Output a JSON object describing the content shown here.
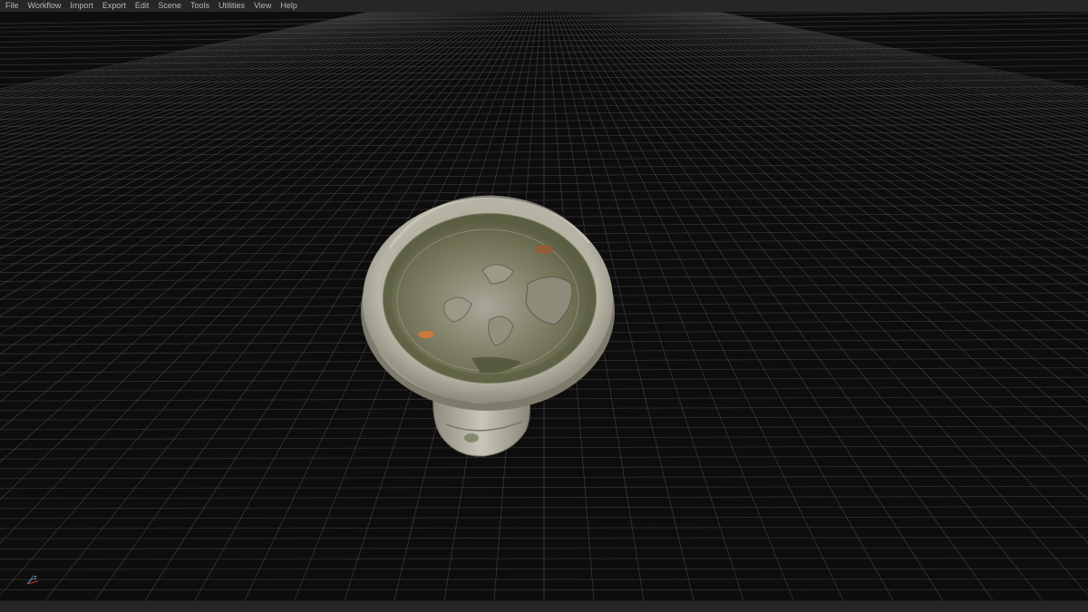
{
  "menu": {
    "items": [
      {
        "label": "File",
        "name": "menu-file"
      },
      {
        "label": "Workflow",
        "name": "menu-workflow"
      },
      {
        "label": "Import",
        "name": "menu-import"
      },
      {
        "label": "Export",
        "name": "menu-export"
      },
      {
        "label": "Edit",
        "name": "menu-edit"
      },
      {
        "label": "Scene",
        "name": "menu-scene"
      },
      {
        "label": "Tools",
        "name": "menu-tools"
      },
      {
        "label": "Utilities",
        "name": "menu-utilities"
      },
      {
        "label": "View",
        "name": "menu-view"
      },
      {
        "label": "Help",
        "name": "menu-help"
      }
    ]
  },
  "viewport": {
    "axis_gizmo": {
      "z_label": "Z",
      "icon": "axis-gizmo-icon"
    },
    "model": {
      "icon": "birdbath-3d-model"
    }
  },
  "colors": {
    "background": "#0c0c0c",
    "menubar": "#262626",
    "menu_text": "#b8b8b8",
    "grid_line": "#5a5a5a"
  }
}
